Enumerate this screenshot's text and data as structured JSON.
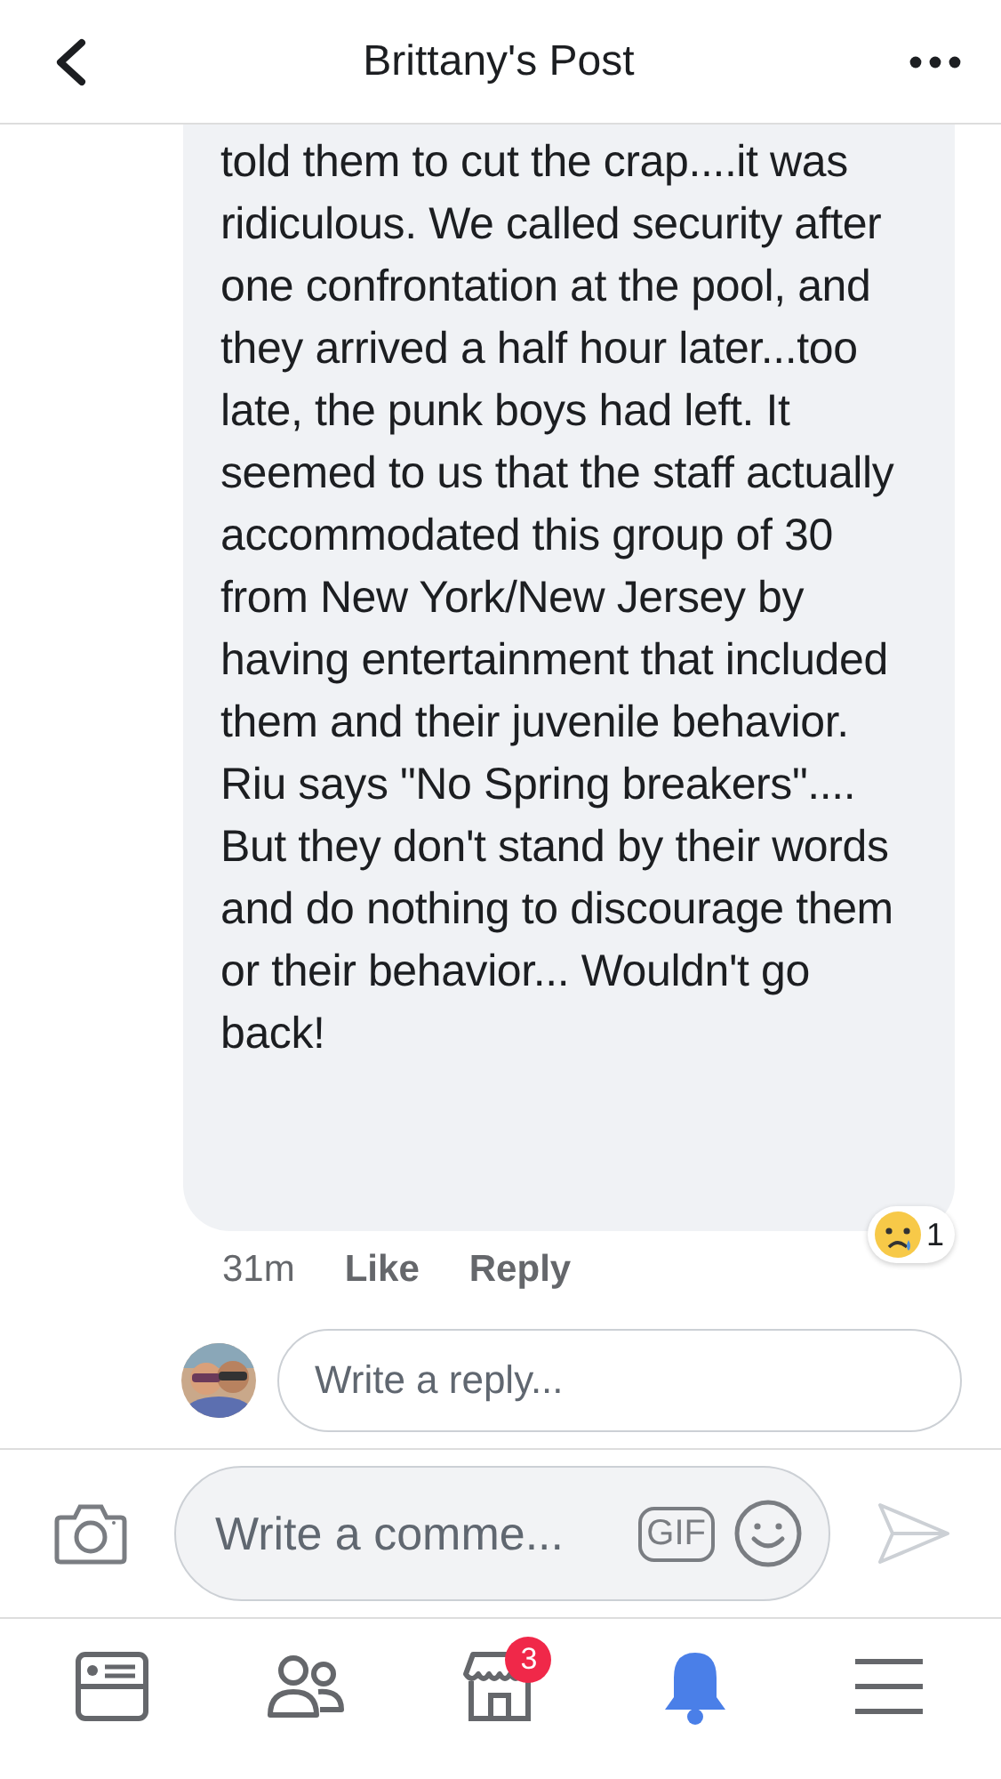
{
  "header": {
    "title": "Brittany's Post"
  },
  "comment": {
    "text": "told them to cut the crap....it was ridiculous. We called security after one confrontation at the pool,  and they arrived a half hour later...too late, the punk boys had left. It seemed to us that the staff actually accommodated this group of 30 from New York/New Jersey by having entertainment that included them and their juvenile behavior. Riu says \"No Spring breakers\".... But they don't stand by their words and do nothing to discourage them or their behavior... Wouldn't go back!",
    "time": "31m",
    "actions": [
      "Like",
      "Reply"
    ],
    "reaction_count": "1"
  },
  "reply_box": {
    "placeholder": "Write a reply..."
  },
  "comment_box": {
    "placeholder": "Write a comme...",
    "gif": "GIF"
  },
  "tabs": [
    {
      "kind": "feed",
      "selected": false
    },
    {
      "kind": "friends",
      "selected": false
    },
    {
      "kind": "marketplace",
      "selected": false,
      "badge": "3"
    },
    {
      "kind": "notifications",
      "selected": true
    },
    {
      "kind": "menu",
      "selected": false
    }
  ]
}
